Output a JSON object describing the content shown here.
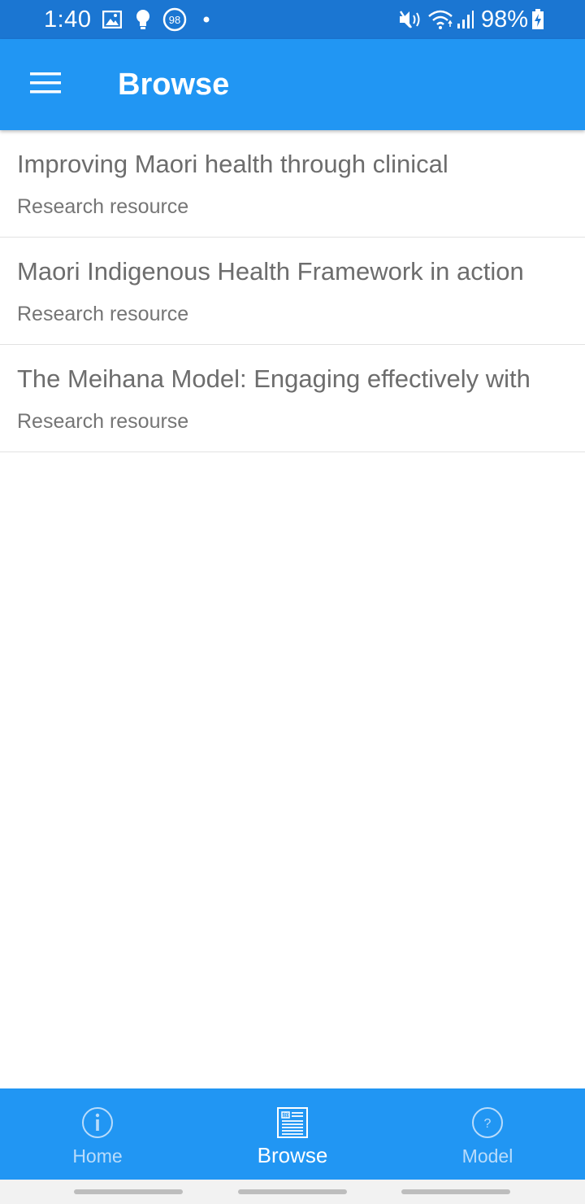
{
  "status_bar": {
    "time": "1:40",
    "notification_badge": "98",
    "battery": "98%",
    "icons": [
      "image-icon",
      "bulb-icon",
      "badge-icon",
      "dot-icon",
      "mute-icon",
      "wifi-icon",
      "signal-icon",
      "battery-icon"
    ]
  },
  "app_bar": {
    "title": "Browse",
    "menu_icon": "hamburger-menu-icon"
  },
  "list": {
    "items": [
      {
        "title": "Improving Maori health through clinical",
        "subtitle": "Research resource"
      },
      {
        "title": "Maori Indigenous Health Framework in action",
        "subtitle": "Research resource"
      },
      {
        "title": "The Meihana Model: Engaging effectively with",
        "subtitle": "Research resourse"
      }
    ]
  },
  "bottom_nav": {
    "items": [
      {
        "label": "Home",
        "icon": "info-icon",
        "active": false
      },
      {
        "label": "Browse",
        "icon": "newspaper-icon",
        "active": true
      },
      {
        "label": "Model",
        "icon": "question-icon",
        "active": false
      }
    ]
  },
  "colors": {
    "status_bar": "#1b76d2",
    "primary": "#2196f3",
    "inactive_nav": "#b9dcfb",
    "text_primary": "#6d6d6d",
    "divider": "#e2e2e2"
  }
}
